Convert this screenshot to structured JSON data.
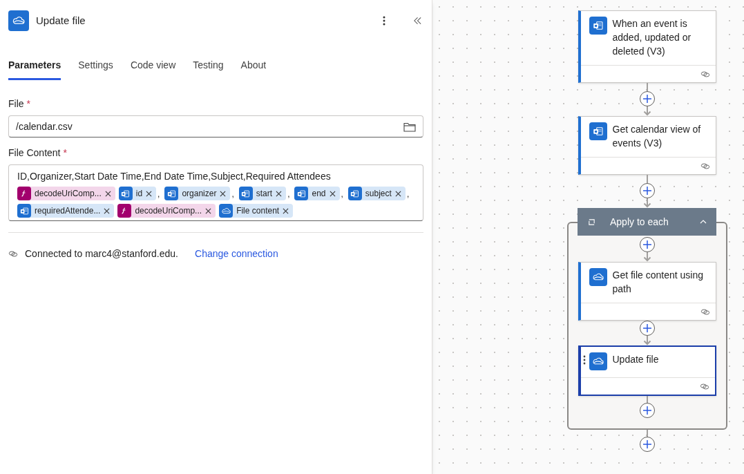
{
  "panel": {
    "title": "Update file"
  },
  "tabs": [
    {
      "label": "Parameters",
      "selected": true
    },
    {
      "label": "Settings",
      "selected": false
    },
    {
      "label": "Code view",
      "selected": false
    },
    {
      "label": "Testing",
      "selected": false
    },
    {
      "label": "About",
      "selected": false
    }
  ],
  "file_field": {
    "label": "File",
    "required_mark": "*",
    "value": "/calendar.csv"
  },
  "content_field": {
    "label": "File Content",
    "required_mark": "*",
    "text": "ID,Organizer,Start Date Time,End Date Time,Subject,Required Attendees",
    "tokens": [
      {
        "kind": "expression",
        "label": "decodeUriComp..."
      },
      {
        "kind": "outlook",
        "label": "id",
        "after": ","
      },
      {
        "kind": "outlook",
        "label": "organizer",
        "after": ","
      },
      {
        "kind": "outlook",
        "label": "start",
        "after": ","
      },
      {
        "kind": "outlook",
        "label": "end",
        "after": ","
      },
      {
        "kind": "outlook",
        "label": "subject",
        "after": ","
      },
      {
        "kind": "outlook",
        "label": "requiredAttende..."
      },
      {
        "kind": "expression",
        "label": "decodeUriComp..."
      },
      {
        "kind": "onedrive",
        "label": "File content"
      }
    ]
  },
  "connection": {
    "text": "Connected to marc4@stanford.edu.",
    "link": "Change connection"
  },
  "flow": [
    {
      "kind": "outlook",
      "title": "When an event is added, updated or deleted (V3)",
      "selected": false
    },
    {
      "kind": "outlook",
      "title": "Get calendar view of events (V3)",
      "selected": false
    },
    {
      "kind": "loop",
      "title": "Apply to each",
      "expanded": true,
      "children": [
        {
          "kind": "onedrive",
          "title": "Get file content using path",
          "selected": false
        },
        {
          "kind": "onedrive",
          "title": "Update file",
          "selected": true
        }
      ]
    }
  ]
}
